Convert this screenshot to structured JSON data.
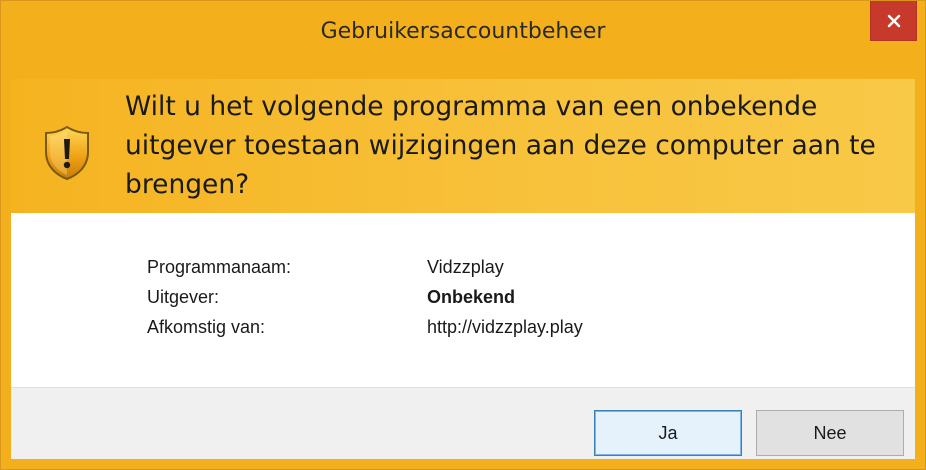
{
  "window": {
    "title": "Gebruikersaccountbeheer"
  },
  "header": {
    "icon": "uac-shield-warning-icon",
    "question": "Wilt u het volgende programma van een onbekende uitgever toestaan wijzigingen aan deze computer aan te brengen?"
  },
  "details": [
    {
      "label": "Programmanaam:",
      "value": "Vidzzplay"
    },
    {
      "label": "Uitgever:",
      "value": "Onbekend"
    },
    {
      "label": "Afkomstig van:",
      "value": "http://vidzzplay.play"
    }
  ],
  "buttons": {
    "yes": "Ja",
    "no": "Nee"
  },
  "colors": {
    "title_bar": "#f4b01c",
    "header": "#f8c13a",
    "close_button": "#c7392a",
    "footer": "#f0f0f0"
  }
}
